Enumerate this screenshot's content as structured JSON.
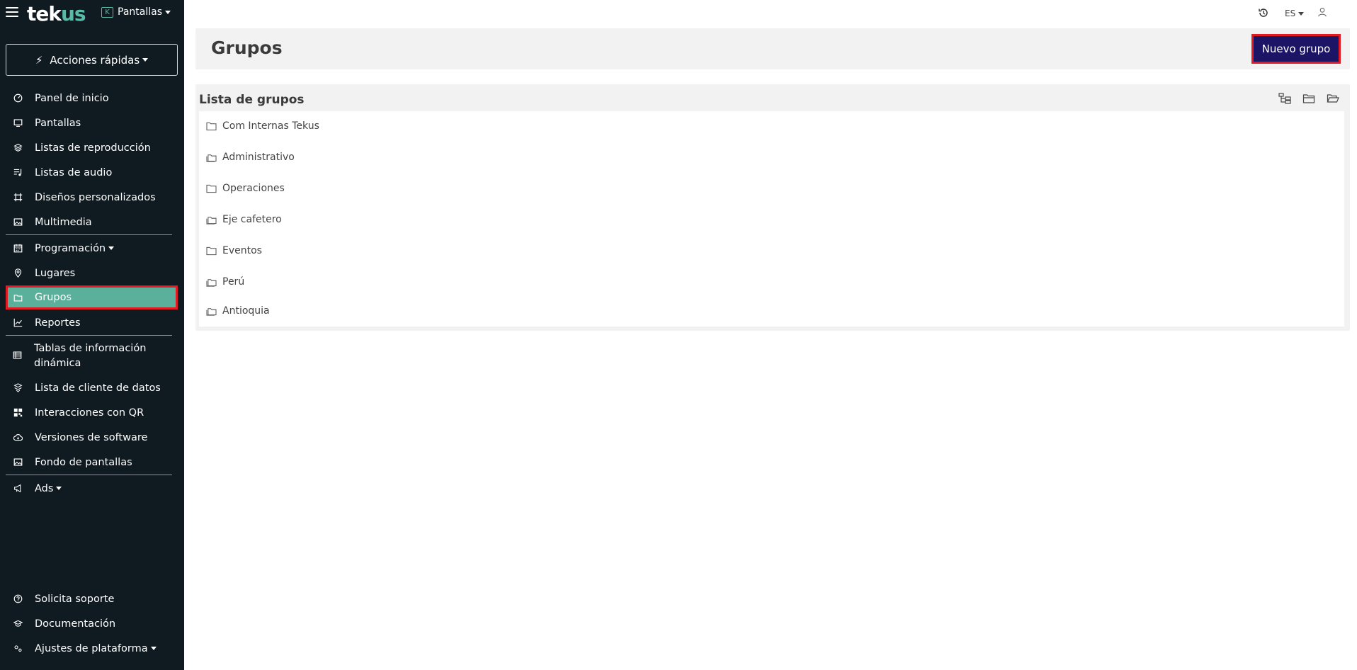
{
  "app": {
    "logo_main": "tek",
    "logo_accent": "us",
    "company_badge": "K",
    "company_name": "Pantallas"
  },
  "sidebar": {
    "quick_actions": "Acciones rápidas",
    "items": [
      {
        "label": "Panel de inicio",
        "icon": "gauge-icon"
      },
      {
        "label": "Pantallas",
        "icon": "monitor-icon"
      },
      {
        "label": "Listas de reproducción",
        "icon": "layers-icon"
      },
      {
        "label": "Listas de audio",
        "icon": "audio-list-icon"
      },
      {
        "label": "Diseños personalizados",
        "icon": "frame-icon"
      },
      {
        "label": "Multimedia",
        "icon": "image-icon"
      },
      {
        "label": "Programación",
        "icon": "calendar-icon"
      },
      {
        "label": "Lugares",
        "icon": "map-pin-icon"
      },
      {
        "label": "Grupos",
        "icon": "folder-icon"
      },
      {
        "label": "Reportes",
        "icon": "chart-line-icon"
      },
      {
        "label": "Tablas de información dinámica",
        "icon": "table-icon"
      },
      {
        "label": "Lista de cliente de datos",
        "icon": "data-client-icon"
      },
      {
        "label": "Interacciones con QR",
        "icon": "qr-icon"
      },
      {
        "label": "Versiones de software",
        "icon": "cloud-icon"
      },
      {
        "label": "Fondo de pantallas",
        "icon": "wallpaper-icon"
      },
      {
        "label": "Ads",
        "icon": "megaphone-icon"
      }
    ],
    "bottom": [
      {
        "label": "Solicita soporte",
        "icon": "help-icon"
      },
      {
        "label": "Documentación",
        "icon": "graduation-icon"
      },
      {
        "label": "Ajustes de plataforma",
        "icon": "settings-icon"
      }
    ]
  },
  "header": {
    "language": "ES"
  },
  "page": {
    "title": "Grupos",
    "new_button": "Nuevo grupo",
    "list_title": "Lista de grupos",
    "groups": [
      {
        "name": "Com Internas Tekus",
        "has_children": false
      },
      {
        "name": "Administrativo",
        "has_children": true
      },
      {
        "name": "Operaciones",
        "has_children": false
      },
      {
        "name": "Eje cafetero",
        "has_children": true
      },
      {
        "name": "Eventos",
        "has_children": false
      },
      {
        "name": "Perú",
        "has_children": true
      },
      {
        "name": "Antioquia",
        "has_children": true
      }
    ]
  },
  "colors": {
    "sidebar_bg": "#0f1a21",
    "accent": "#5bb09b",
    "primary_button": "#1c1464",
    "highlight": "#e01b24"
  }
}
